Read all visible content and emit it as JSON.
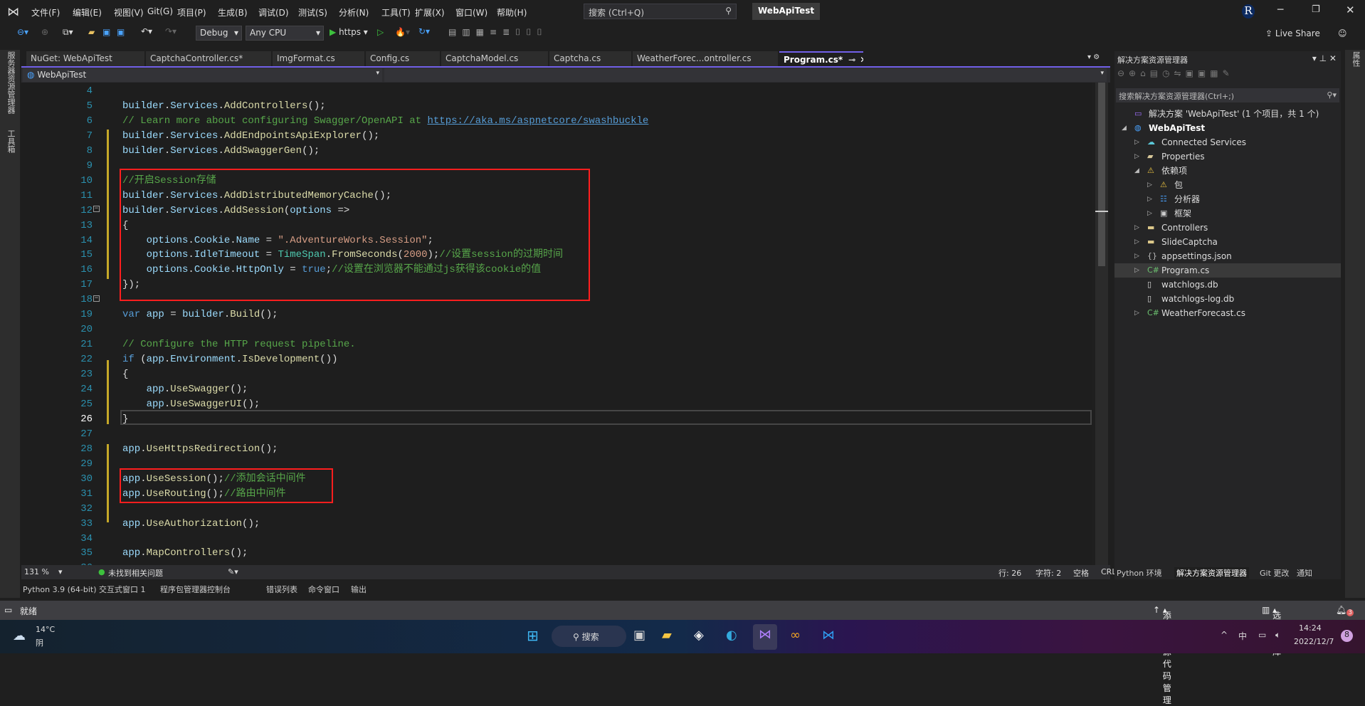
{
  "menubar": {
    "items": [
      "文件(F)",
      "编辑(E)",
      "视图(V)",
      "Git(G)",
      "项目(P)",
      "生成(B)",
      "调试(D)",
      "测试(S)",
      "分析(N)",
      "工具(T)",
      "扩展(X)",
      "窗口(W)",
      "帮助(H)"
    ],
    "search_placeholder": "搜索 (Ctrl+Q)",
    "title": "WebApiTest",
    "avatar": "R"
  },
  "toolbar": {
    "config": "Debug",
    "platform": "Any CPU",
    "run_target": "https",
    "live_share": "Live Share"
  },
  "left_strip": [
    "服务器资源管理器",
    "工具箱"
  ],
  "right_strip": [
    "属性"
  ],
  "tabs": [
    {
      "label": "NuGet: WebApiTest"
    },
    {
      "label": "CaptchaController.cs*"
    },
    {
      "label": "ImgFormat.cs"
    },
    {
      "label": "Config.cs"
    },
    {
      "label": "CaptchaModel.cs"
    },
    {
      "label": "Captcha.cs"
    },
    {
      "label": "WeatherForec...ontroller.cs"
    },
    {
      "label": "Program.cs*",
      "active": true
    }
  ],
  "navbar": {
    "project": "WebApiTest"
  },
  "editor": {
    "current_line": 26,
    "lines": [
      {
        "n": 4,
        "tk": []
      },
      {
        "n": 5,
        "tk": [
          [
            "id",
            "builder"
          ],
          [
            "p",
            "."
          ],
          [
            "id",
            "Services"
          ],
          [
            "p",
            "."
          ],
          [
            "m",
            "AddControllers"
          ],
          [
            "p",
            "();"
          ]
        ]
      },
      {
        "n": 6,
        "tk": [
          [
            "c",
            "// Learn more about configuring Swagger/OpenAPI at "
          ],
          [
            "u",
            "https://aka.ms/aspnetcore/swashbuckle"
          ]
        ]
      },
      {
        "n": 7,
        "tk": [
          [
            "id",
            "builder"
          ],
          [
            "p",
            "."
          ],
          [
            "id",
            "Services"
          ],
          [
            "p",
            "."
          ],
          [
            "m",
            "AddEndpointsApiExplorer"
          ],
          [
            "p",
            "();"
          ]
        ]
      },
      {
        "n": 8,
        "tk": [
          [
            "id",
            "builder"
          ],
          [
            "p",
            "."
          ],
          [
            "id",
            "Services"
          ],
          [
            "p",
            "."
          ],
          [
            "m",
            "AddSwaggerGen"
          ],
          [
            "p",
            "();"
          ]
        ]
      },
      {
        "n": 9,
        "tk": []
      },
      {
        "n": 10,
        "tk": [
          [
            "c",
            "//开启Session存储"
          ]
        ]
      },
      {
        "n": 11,
        "tk": [
          [
            "id",
            "builder"
          ],
          [
            "p",
            "."
          ],
          [
            "id",
            "Services"
          ],
          [
            "p",
            "."
          ],
          [
            "m",
            "AddDistributedMemoryCache"
          ],
          [
            "p",
            "();"
          ]
        ]
      },
      {
        "n": 12,
        "tk": [
          [
            "id",
            "builder"
          ],
          [
            "p",
            "."
          ],
          [
            "id",
            "Services"
          ],
          [
            "p",
            "."
          ],
          [
            "m",
            "AddSession"
          ],
          [
            "p",
            "("
          ],
          [
            "id",
            "options"
          ],
          [
            "p",
            " =>"
          ]
        ]
      },
      {
        "n": 13,
        "tk": [
          [
            "p",
            "{"
          ]
        ]
      },
      {
        "n": 14,
        "tk": [
          [
            "p",
            "    "
          ],
          [
            "id",
            "options"
          ],
          [
            "p",
            "."
          ],
          [
            "id",
            "Cookie"
          ],
          [
            "p",
            "."
          ],
          [
            "id",
            "Name"
          ],
          [
            "p",
            " = "
          ],
          [
            "s",
            "\".AdventureWorks.Session\""
          ],
          [
            "p",
            ";"
          ]
        ]
      },
      {
        "n": 15,
        "tk": [
          [
            "p",
            "    "
          ],
          [
            "id",
            "options"
          ],
          [
            "p",
            "."
          ],
          [
            "id",
            "IdleTimeout"
          ],
          [
            "p",
            " = "
          ],
          [
            "t",
            "TimeSpan"
          ],
          [
            "p",
            "."
          ],
          [
            "m",
            "FromSeconds"
          ],
          [
            "p",
            "("
          ],
          [
            "s",
            "2000"
          ],
          [
            "p",
            ");"
          ],
          [
            "c",
            "//设置session的过期时间"
          ]
        ]
      },
      {
        "n": 16,
        "tk": [
          [
            "p",
            "    "
          ],
          [
            "id",
            "options"
          ],
          [
            "p",
            "."
          ],
          [
            "id",
            "Cookie"
          ],
          [
            "p",
            "."
          ],
          [
            "id",
            "HttpOnly"
          ],
          [
            "p",
            " = "
          ],
          [
            "k",
            "true"
          ],
          [
            "p",
            ";"
          ],
          [
            "c",
            "//设置在浏览器不能通过js获得该cookie的值"
          ]
        ]
      },
      {
        "n": 17,
        "tk": [
          [
            "p",
            "});"
          ]
        ]
      },
      {
        "n": 18,
        "tk": []
      },
      {
        "n": 19,
        "tk": [
          [
            "k",
            "var"
          ],
          [
            "p",
            " "
          ],
          [
            "id",
            "app"
          ],
          [
            "p",
            " = "
          ],
          [
            "id",
            "builder"
          ],
          [
            "p",
            "."
          ],
          [
            "m",
            "Build"
          ],
          [
            "p",
            "();"
          ]
        ]
      },
      {
        "n": 20,
        "tk": []
      },
      {
        "n": 21,
        "tk": [
          [
            "c",
            "// Configure the HTTP request pipeline."
          ]
        ]
      },
      {
        "n": 22,
        "tk": [
          [
            "k",
            "if"
          ],
          [
            "p",
            " ("
          ],
          [
            "id",
            "app"
          ],
          [
            "p",
            "."
          ],
          [
            "id",
            "Environment"
          ],
          [
            "p",
            "."
          ],
          [
            "m",
            "IsDevelopment"
          ],
          [
            "p",
            "())"
          ]
        ]
      },
      {
        "n": 23,
        "tk": [
          [
            "p",
            "{"
          ]
        ]
      },
      {
        "n": 24,
        "tk": [
          [
            "p",
            "    "
          ],
          [
            "id",
            "app"
          ],
          [
            "p",
            "."
          ],
          [
            "m",
            "UseSwagger"
          ],
          [
            "p",
            "();"
          ]
        ]
      },
      {
        "n": 25,
        "tk": [
          [
            "p",
            "    "
          ],
          [
            "id",
            "app"
          ],
          [
            "p",
            "."
          ],
          [
            "m",
            "UseSwaggerUI"
          ],
          [
            "p",
            "();"
          ]
        ]
      },
      {
        "n": 26,
        "tk": [
          [
            "p",
            "}"
          ]
        ]
      },
      {
        "n": 27,
        "tk": []
      },
      {
        "n": 28,
        "tk": [
          [
            "id",
            "app"
          ],
          [
            "p",
            "."
          ],
          [
            "m",
            "UseHttpsRedirection"
          ],
          [
            "p",
            "();"
          ]
        ]
      },
      {
        "n": 29,
        "tk": []
      },
      {
        "n": 30,
        "tk": [
          [
            "id",
            "app"
          ],
          [
            "p",
            "."
          ],
          [
            "m",
            "UseSession"
          ],
          [
            "p",
            "();"
          ],
          [
            "c",
            "//添加会话中间件"
          ]
        ]
      },
      {
        "n": 31,
        "tk": [
          [
            "id",
            "app"
          ],
          [
            "p",
            "."
          ],
          [
            "m",
            "UseRouting"
          ],
          [
            "p",
            "();"
          ],
          [
            "c",
            "//路由中间件"
          ]
        ]
      },
      {
        "n": 32,
        "tk": []
      },
      {
        "n": 33,
        "tk": [
          [
            "id",
            "app"
          ],
          [
            "p",
            "."
          ],
          [
            "m",
            "UseAuthorization"
          ],
          [
            "p",
            "();"
          ]
        ]
      },
      {
        "n": 34,
        "tk": []
      },
      {
        "n": 35,
        "tk": [
          [
            "id",
            "app"
          ],
          [
            "p",
            "."
          ],
          [
            "m",
            "MapControllers"
          ],
          [
            "p",
            "();"
          ]
        ]
      },
      {
        "n": 36,
        "tk": []
      }
    ]
  },
  "editor_status": {
    "zoom": "131 %",
    "issues": "未找到相关问题",
    "line": "行: 26",
    "char": "字符: 2",
    "whitespace": "空格",
    "eol": "CRLF"
  },
  "tool_windows": [
    "Python 3.9 (64-bit) 交互式窗口 1",
    "程序包管理器控制台",
    "错误列表",
    "命令窗口",
    "输出"
  ],
  "solution_explorer": {
    "title": "解决方案资源管理器",
    "search_placeholder": "搜索解决方案资源管理器(Ctrl+;)",
    "items": [
      {
        "label": "解决方案 'WebApiTest' (1 个项目，共 1 个)",
        "icon": "solution-icon",
        "level": 0,
        "expander": ""
      },
      {
        "label": "WebApiTest",
        "icon": "web-project-icon",
        "level": 0,
        "expander": "◢",
        "bold": true
      },
      {
        "label": "Connected Services",
        "icon": "cloud-icon",
        "level": 1,
        "expander": "▷"
      },
      {
        "label": "Properties",
        "icon": "wrench-folder-icon",
        "level": 1,
        "expander": "▷"
      },
      {
        "label": "依赖项",
        "icon": "dependencies-icon",
        "level": 1,
        "expander": "◢"
      },
      {
        "label": "包",
        "icon": "package-icon",
        "level": 2,
        "expander": "▷"
      },
      {
        "label": "分析器",
        "icon": "analyzer-icon",
        "level": 2,
        "expander": "▷"
      },
      {
        "label": "框架",
        "icon": "framework-icon",
        "level": 2,
        "expander": "▷"
      },
      {
        "label": "Controllers",
        "icon": "folder-icon",
        "level": 1,
        "expander": "▷"
      },
      {
        "label": "SlideCaptcha",
        "icon": "folder-icon",
        "level": 1,
        "expander": "▷"
      },
      {
        "label": "appsettings.json",
        "icon": "json-file-icon",
        "level": 1,
        "expander": "▷"
      },
      {
        "label": "Program.cs",
        "icon": "csharp-file-icon",
        "level": 1,
        "expander": "▷",
        "selected": true
      },
      {
        "label": "watchlogs.db",
        "icon": "db-file-icon",
        "level": 1,
        "expander": ""
      },
      {
        "label": "watchlogs-log.db",
        "icon": "db-file-icon",
        "level": 1,
        "expander": ""
      },
      {
        "label": "WeatherForecast.cs",
        "icon": "csharp-file-icon",
        "level": 1,
        "expander": "▷"
      }
    ],
    "bottom_tabs": [
      "Python 环境",
      "解决方案资源管理器",
      "Git 更改",
      "通知"
    ]
  },
  "statusbar": {
    "ready": "就绪",
    "add_source_control": "添加到源代码管理",
    "select_repo": "选择仓库",
    "notifications": "3"
  },
  "taskbar": {
    "temp": "14°C",
    "weather": "阴",
    "search": "搜索",
    "ime": "中",
    "time": "14:24",
    "date": "2022/12/7",
    "badge": "8"
  },
  "colors": {
    "accent": "#7160e8",
    "highlight_box": "#ff1e1e",
    "comment": "#57a64a",
    "change_margin": "#c5a828"
  }
}
